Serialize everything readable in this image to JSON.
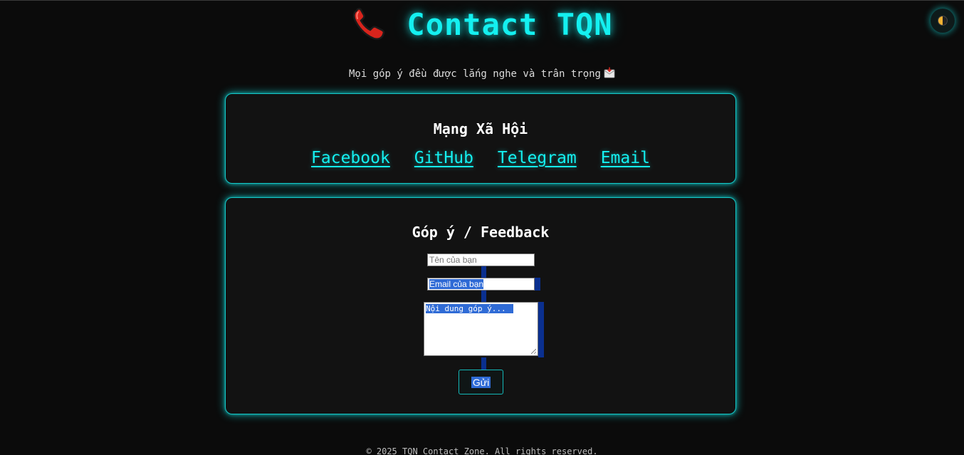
{
  "header": {
    "title": "Contact TQN",
    "phone_icon": "telephone-receiver-icon",
    "theme_toggle_icon": "half-moon-icon",
    "accent_color": "#14f0f0"
  },
  "subtitle": {
    "text": "Mọi góp ý đều được lắng nghe và trân trọng",
    "icon": "incoming-envelope-icon"
  },
  "social": {
    "title": "Mạng Xã Hội",
    "links": [
      {
        "label": "Facebook"
      },
      {
        "label": "GitHub"
      },
      {
        "label": "Telegram"
      },
      {
        "label": "Email"
      }
    ]
  },
  "feedback": {
    "title": "Góp ý / Feedback",
    "name_placeholder": "Tên của bạn",
    "email_placeholder": "Email của bạn",
    "message_placeholder": "Nội dung góp ý...",
    "submit_label": "Gửi"
  },
  "footer": {
    "text": "© 2025 TQN Contact Zone. All rights reserved."
  }
}
